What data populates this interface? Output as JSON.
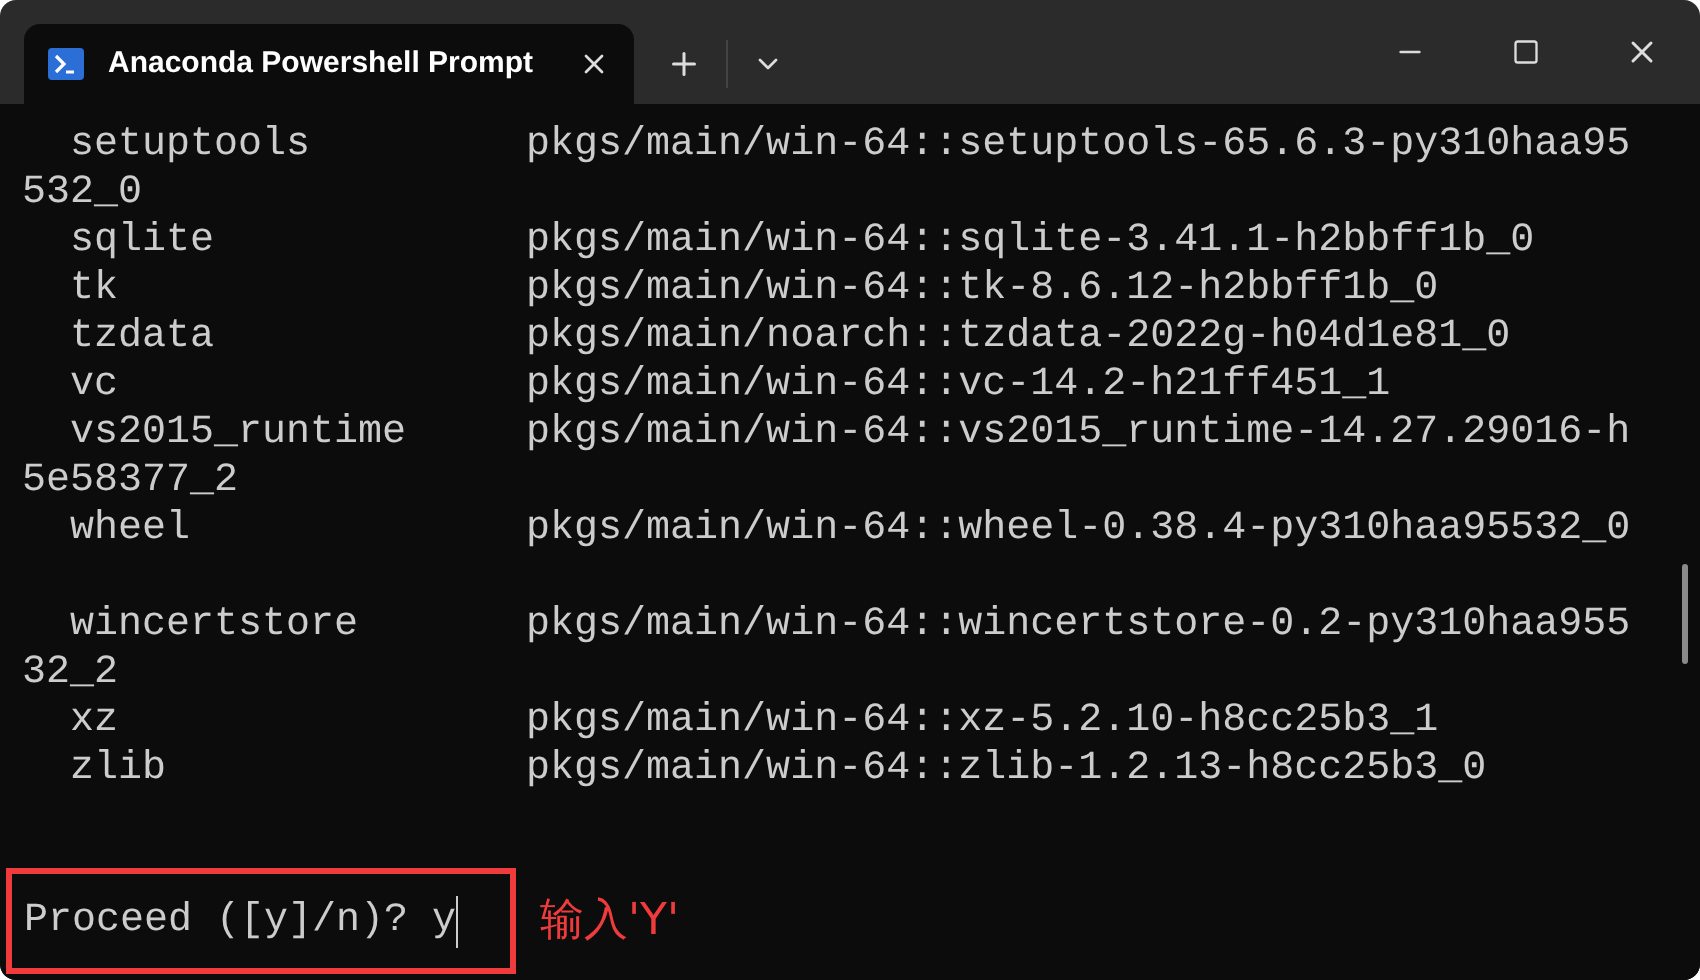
{
  "tab": {
    "title": "Anaconda Powershell Prompt"
  },
  "terminal": {
    "blocks": [
      [
        "  setuptools         pkgs/main/win-64::setuptools-65.6.3-py310haa95",
        "532_0",
        "  sqlite             pkgs/main/win-64::sqlite-3.41.1-h2bbff1b_0",
        "  tk                 pkgs/main/win-64::tk-8.6.12-h2bbff1b_0",
        "  tzdata             pkgs/main/noarch::tzdata-2022g-h04d1e81_0",
        "  vc                 pkgs/main/win-64::vc-14.2-h21ff451_1",
        "  vs2015_runtime     pkgs/main/win-64::vs2015_runtime-14.27.29016-h",
        "5e58377_2",
        "  wheel              pkgs/main/win-64::wheel-0.38.4-py310haa95532_0"
      ],
      [
        "  wincertstore       pkgs/main/win-64::wincertstore-0.2-py310haa955",
        "32_2",
        "  xz                 pkgs/main/win-64::xz-5.2.10-h8cc25b3_1",
        "  zlib               pkgs/main/win-64::zlib-1.2.13-h8cc25b3_0"
      ]
    ],
    "prompt": {
      "text": "Proceed ([y]/n)?",
      "input": "y"
    }
  },
  "annotation": {
    "text": "输入'Y'"
  }
}
